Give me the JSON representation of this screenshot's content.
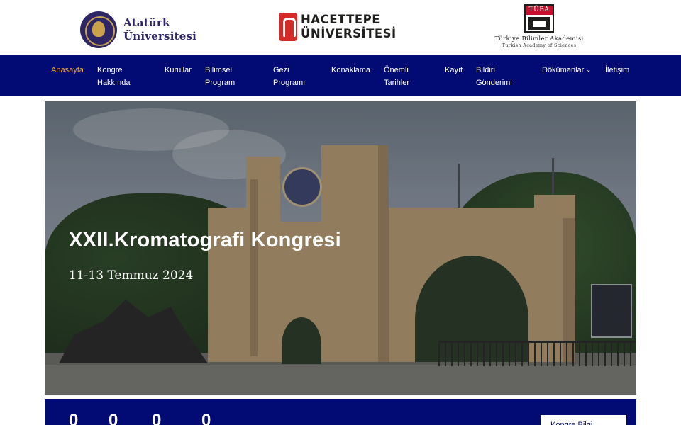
{
  "logos": {
    "ataturk": {
      "line1": "Atatürk",
      "line2": "Üniversitesi"
    },
    "hacettepe": {
      "line1": "HACETTEPE",
      "line2": "ÜNİVERSİTESİ"
    },
    "tuba": {
      "badge": "TÜBA",
      "line1": "Türkiye Bilimler Akademisi",
      "line2": "Turkish Academy of Sciences"
    }
  },
  "nav": {
    "items": [
      {
        "label": "Anasayfa",
        "active": true
      },
      {
        "label": "Kongre",
        "label2": "Hakkında"
      },
      {
        "label": "Kurullar"
      },
      {
        "label": "Bilimsel",
        "label2": "Program"
      },
      {
        "label": "Gezi",
        "label2": "Programı"
      },
      {
        "label": "Konaklama"
      },
      {
        "label": "Önemli",
        "label2": "Tarihler"
      },
      {
        "label": "Kayıt"
      },
      {
        "label": "Bildiri",
        "label2": "Gönderimi"
      },
      {
        "label": "Dökümanlar",
        "caret": "⌄"
      },
      {
        "label": "İletişim"
      }
    ]
  },
  "hero": {
    "title": "XXII.Kromatografi Kongresi",
    "date": "11-13 Temmuz 2024"
  },
  "countdown": {
    "values": [
      "0",
      "0",
      "0",
      "0"
    ],
    "button_label": "Kongre Bilgi"
  },
  "colors": {
    "nav_bg": "#020b73",
    "active_nav": "#e8a33a",
    "ataturk_brand": "#2e2566",
    "hacettepe_red": "#d42a2a",
    "tuba_red": "#c8102e"
  }
}
